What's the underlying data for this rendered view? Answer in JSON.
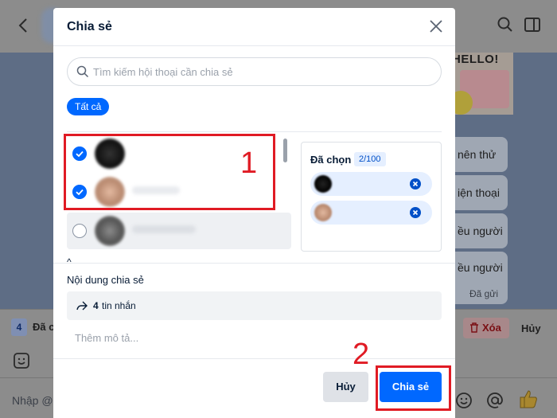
{
  "background": {
    "sticker_text": "HELLO!",
    "bubbles": [
      "nên thử",
      "iện thoại",
      "ều người",
      "ều người"
    ],
    "bubble_status": "Đã gửi",
    "selection_count": "4",
    "selection_label": "Đã c",
    "delete_label": "Xóa",
    "cancel_label": "Hủy",
    "composer_placeholder": "Nhập @"
  },
  "modal": {
    "title": "Chia sẻ",
    "search_placeholder": "Tìm kiếm hội thoại cần chia sẻ",
    "filter_all": "Tất cả",
    "contacts": [
      {
        "checked": true
      },
      {
        "checked": true
      },
      {
        "checked": false
      }
    ],
    "collapse_glyph": "^",
    "selected_label": "Đã chọn",
    "selected_count": "2/100",
    "content_title": "Nội dung chia sẻ",
    "message_count": "4",
    "message_unit": "tin nhắn",
    "description_placeholder": "Thêm mô tả...",
    "cancel_button": "Hủy",
    "share_button": "Chia sẻ"
  },
  "annotations": {
    "step1": "1",
    "step2": "2",
    "color": "#e01b24"
  },
  "colors": {
    "accent": "#0068ff",
    "overlay": "#8c8c8c"
  }
}
